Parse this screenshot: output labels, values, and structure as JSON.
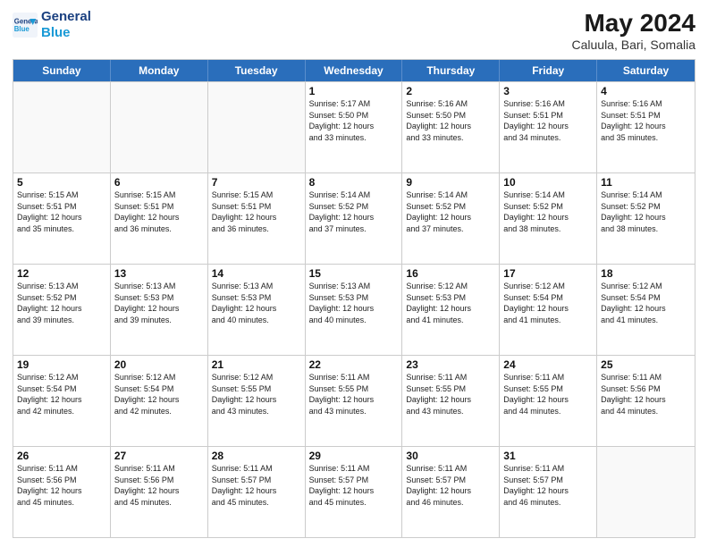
{
  "logo": {
    "line1": "General",
    "line2": "Blue"
  },
  "title": "May 2024",
  "subtitle": "Caluula, Bari, Somalia",
  "header_days": [
    "Sunday",
    "Monday",
    "Tuesday",
    "Wednesday",
    "Thursday",
    "Friday",
    "Saturday"
  ],
  "weeks": [
    [
      {
        "day": "",
        "info": ""
      },
      {
        "day": "",
        "info": ""
      },
      {
        "day": "",
        "info": ""
      },
      {
        "day": "1",
        "info": "Sunrise: 5:17 AM\nSunset: 5:50 PM\nDaylight: 12 hours\nand 33 minutes."
      },
      {
        "day": "2",
        "info": "Sunrise: 5:16 AM\nSunset: 5:50 PM\nDaylight: 12 hours\nand 33 minutes."
      },
      {
        "day": "3",
        "info": "Sunrise: 5:16 AM\nSunset: 5:51 PM\nDaylight: 12 hours\nand 34 minutes."
      },
      {
        "day": "4",
        "info": "Sunrise: 5:16 AM\nSunset: 5:51 PM\nDaylight: 12 hours\nand 35 minutes."
      }
    ],
    [
      {
        "day": "5",
        "info": "Sunrise: 5:15 AM\nSunset: 5:51 PM\nDaylight: 12 hours\nand 35 minutes."
      },
      {
        "day": "6",
        "info": "Sunrise: 5:15 AM\nSunset: 5:51 PM\nDaylight: 12 hours\nand 36 minutes."
      },
      {
        "day": "7",
        "info": "Sunrise: 5:15 AM\nSunset: 5:51 PM\nDaylight: 12 hours\nand 36 minutes."
      },
      {
        "day": "8",
        "info": "Sunrise: 5:14 AM\nSunset: 5:52 PM\nDaylight: 12 hours\nand 37 minutes."
      },
      {
        "day": "9",
        "info": "Sunrise: 5:14 AM\nSunset: 5:52 PM\nDaylight: 12 hours\nand 37 minutes."
      },
      {
        "day": "10",
        "info": "Sunrise: 5:14 AM\nSunset: 5:52 PM\nDaylight: 12 hours\nand 38 minutes."
      },
      {
        "day": "11",
        "info": "Sunrise: 5:14 AM\nSunset: 5:52 PM\nDaylight: 12 hours\nand 38 minutes."
      }
    ],
    [
      {
        "day": "12",
        "info": "Sunrise: 5:13 AM\nSunset: 5:52 PM\nDaylight: 12 hours\nand 39 minutes."
      },
      {
        "day": "13",
        "info": "Sunrise: 5:13 AM\nSunset: 5:53 PM\nDaylight: 12 hours\nand 39 minutes."
      },
      {
        "day": "14",
        "info": "Sunrise: 5:13 AM\nSunset: 5:53 PM\nDaylight: 12 hours\nand 40 minutes."
      },
      {
        "day": "15",
        "info": "Sunrise: 5:13 AM\nSunset: 5:53 PM\nDaylight: 12 hours\nand 40 minutes."
      },
      {
        "day": "16",
        "info": "Sunrise: 5:12 AM\nSunset: 5:53 PM\nDaylight: 12 hours\nand 41 minutes."
      },
      {
        "day": "17",
        "info": "Sunrise: 5:12 AM\nSunset: 5:54 PM\nDaylight: 12 hours\nand 41 minutes."
      },
      {
        "day": "18",
        "info": "Sunrise: 5:12 AM\nSunset: 5:54 PM\nDaylight: 12 hours\nand 41 minutes."
      }
    ],
    [
      {
        "day": "19",
        "info": "Sunrise: 5:12 AM\nSunset: 5:54 PM\nDaylight: 12 hours\nand 42 minutes."
      },
      {
        "day": "20",
        "info": "Sunrise: 5:12 AM\nSunset: 5:54 PM\nDaylight: 12 hours\nand 42 minutes."
      },
      {
        "day": "21",
        "info": "Sunrise: 5:12 AM\nSunset: 5:55 PM\nDaylight: 12 hours\nand 43 minutes."
      },
      {
        "day": "22",
        "info": "Sunrise: 5:11 AM\nSunset: 5:55 PM\nDaylight: 12 hours\nand 43 minutes."
      },
      {
        "day": "23",
        "info": "Sunrise: 5:11 AM\nSunset: 5:55 PM\nDaylight: 12 hours\nand 43 minutes."
      },
      {
        "day": "24",
        "info": "Sunrise: 5:11 AM\nSunset: 5:55 PM\nDaylight: 12 hours\nand 44 minutes."
      },
      {
        "day": "25",
        "info": "Sunrise: 5:11 AM\nSunset: 5:56 PM\nDaylight: 12 hours\nand 44 minutes."
      }
    ],
    [
      {
        "day": "26",
        "info": "Sunrise: 5:11 AM\nSunset: 5:56 PM\nDaylight: 12 hours\nand 45 minutes."
      },
      {
        "day": "27",
        "info": "Sunrise: 5:11 AM\nSunset: 5:56 PM\nDaylight: 12 hours\nand 45 minutes."
      },
      {
        "day": "28",
        "info": "Sunrise: 5:11 AM\nSunset: 5:57 PM\nDaylight: 12 hours\nand 45 minutes."
      },
      {
        "day": "29",
        "info": "Sunrise: 5:11 AM\nSunset: 5:57 PM\nDaylight: 12 hours\nand 45 minutes."
      },
      {
        "day": "30",
        "info": "Sunrise: 5:11 AM\nSunset: 5:57 PM\nDaylight: 12 hours\nand 46 minutes."
      },
      {
        "day": "31",
        "info": "Sunrise: 5:11 AM\nSunset: 5:57 PM\nDaylight: 12 hours\nand 46 minutes."
      },
      {
        "day": "",
        "info": ""
      }
    ]
  ]
}
